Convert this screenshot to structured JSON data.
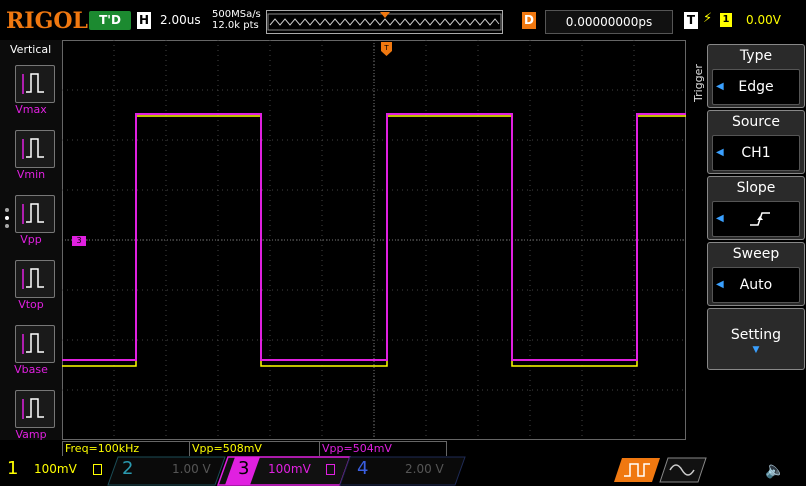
{
  "topbar": {
    "brand": "RIGOL",
    "run_status": "T'D",
    "horizontal_label": "H",
    "timebase": "2.00us",
    "sample_rate": "500MSa/s",
    "memory_depth": "12.0k pts",
    "delay_label": "D",
    "delay_value": "0.00000000ps",
    "trigger_label": "T",
    "trigger_source": "1",
    "trigger_level": "0.00V"
  },
  "left_panel": {
    "title": "Vertical",
    "items": [
      {
        "label": "Vmax",
        "icon": "vmax-icon"
      },
      {
        "label": "Vmin",
        "icon": "vmin-icon"
      },
      {
        "label": "Vpp",
        "icon": "vpp-icon"
      },
      {
        "label": "Vtop",
        "icon": "vtop-icon"
      },
      {
        "label": "Vbase",
        "icon": "vbase-icon"
      },
      {
        "label": "Vamp",
        "icon": "vamp-icon"
      }
    ]
  },
  "right_menu": {
    "title": "Trigger",
    "items": [
      {
        "header": "Type",
        "value": "Edge"
      },
      {
        "header": "Source",
        "value": "CH1"
      },
      {
        "header": "Slope",
        "value": ""
      },
      {
        "header": "Sweep",
        "value": "Auto"
      }
    ],
    "setting_label": "Setting"
  },
  "screen": {
    "ch3_marker": "3",
    "trigger_marker": "T"
  },
  "measurements": [
    {
      "text": "Freq=100kHz",
      "color": "#ffff00"
    },
    {
      "text": "Vpp=508mV",
      "color": "#ffff00"
    },
    {
      "text": "Vpp=504mV",
      "color": "#e020e0"
    }
  ],
  "channels": [
    {
      "number": "1",
      "scale": "100mV",
      "color": "#ffff00",
      "active": true
    },
    {
      "number": "2",
      "scale": "1.00 V",
      "color": "#2a9ab0",
      "active": false
    },
    {
      "number": "3",
      "scale": "100mV",
      "color": "#e020e0",
      "active": true
    },
    {
      "number": "4",
      "scale": "2.00 V",
      "color": "#3a5fe0",
      "active": false
    }
  ],
  "colors": {
    "accent": "#f07810",
    "ch1": "#ffff00",
    "ch3": "#e020e0",
    "grid": "#555555",
    "menu_arrow": "#3aa0ff"
  }
}
